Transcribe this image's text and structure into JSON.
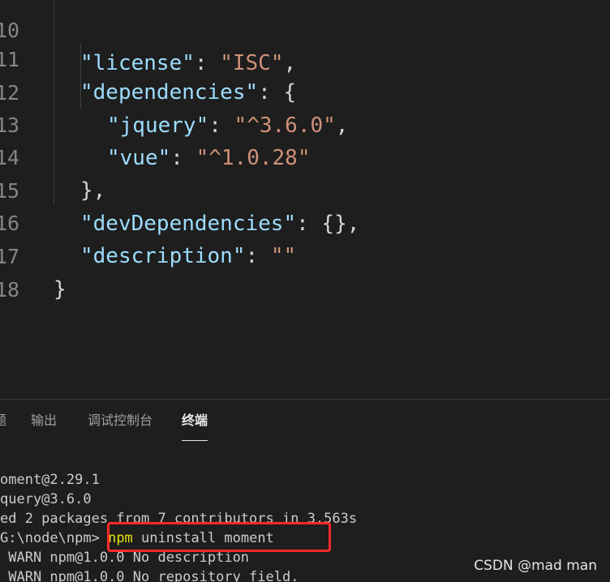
{
  "editor": {
    "lines": [
      {
        "number": "10",
        "key": "\"license\"",
        "colon": ": ",
        "value": "\"ISC\"",
        "tail": ","
      },
      {
        "number": "11",
        "key": "\"dependencies\"",
        "colon": ": ",
        "value": "",
        "tail": "{"
      },
      {
        "number": "12",
        "key": "\"jquery\"",
        "colon": ": ",
        "value": "\"^3.6.0\"",
        "tail": ","
      },
      {
        "number": "13",
        "key": "\"vue\"",
        "colon": ": ",
        "value": "\"^1.0.28\"",
        "tail": ""
      },
      {
        "number": "14",
        "key": "",
        "colon": "",
        "value": "",
        "tail": "},"
      },
      {
        "number": "15",
        "key": "\"devDependencies\"",
        "colon": ": ",
        "value": "",
        "tail": "{},"
      },
      {
        "number": "16",
        "key": "\"description\"",
        "colon": ": ",
        "value": "\"\"",
        "tail": ""
      },
      {
        "number": "17",
        "key": "",
        "colon": "",
        "value": "",
        "tail": "}"
      },
      {
        "number": "18",
        "key": "",
        "colon": "",
        "value": "",
        "tail": ""
      }
    ]
  },
  "panel": {
    "tabs": [
      {
        "label": "题",
        "active": false
      },
      {
        "label": "输出",
        "active": false
      },
      {
        "label": "调试控制台",
        "active": false
      },
      {
        "label": "终端",
        "active": true
      }
    ],
    "terminal": {
      "line1": "oment@2.29.1",
      "line2": "query@3.6.0",
      "line3": "ed 2 packages from 7 contributors in 3.563s",
      "prompt": "G:\\node\\npm>",
      "command_npm": "npm",
      "command_rest": " uninstall moment",
      "warn1": " WARN npm@1.0.0 No description",
      "warn2": " WARN npm@1.0.0 No repository field."
    }
  },
  "watermark": "CSDN @mad man",
  "colors": {
    "background": "#1e1e1e",
    "key": "#9cdcfe",
    "string": "#ce9178",
    "highlight": "#ff2a2a",
    "npm_command": "#e5e510"
  }
}
